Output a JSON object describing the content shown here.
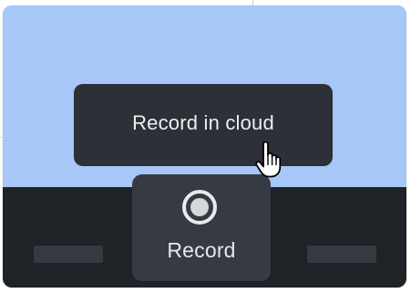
{
  "preview": {
    "background_color": "#a6c7f7"
  },
  "toolbar": {
    "background_color": "#1f2226"
  },
  "record_button": {
    "label": "Record",
    "icon": "record-circle-icon"
  },
  "cloud_option": {
    "label": "Record in cloud"
  },
  "cursor": {
    "icon": "hand-pointer-icon"
  }
}
